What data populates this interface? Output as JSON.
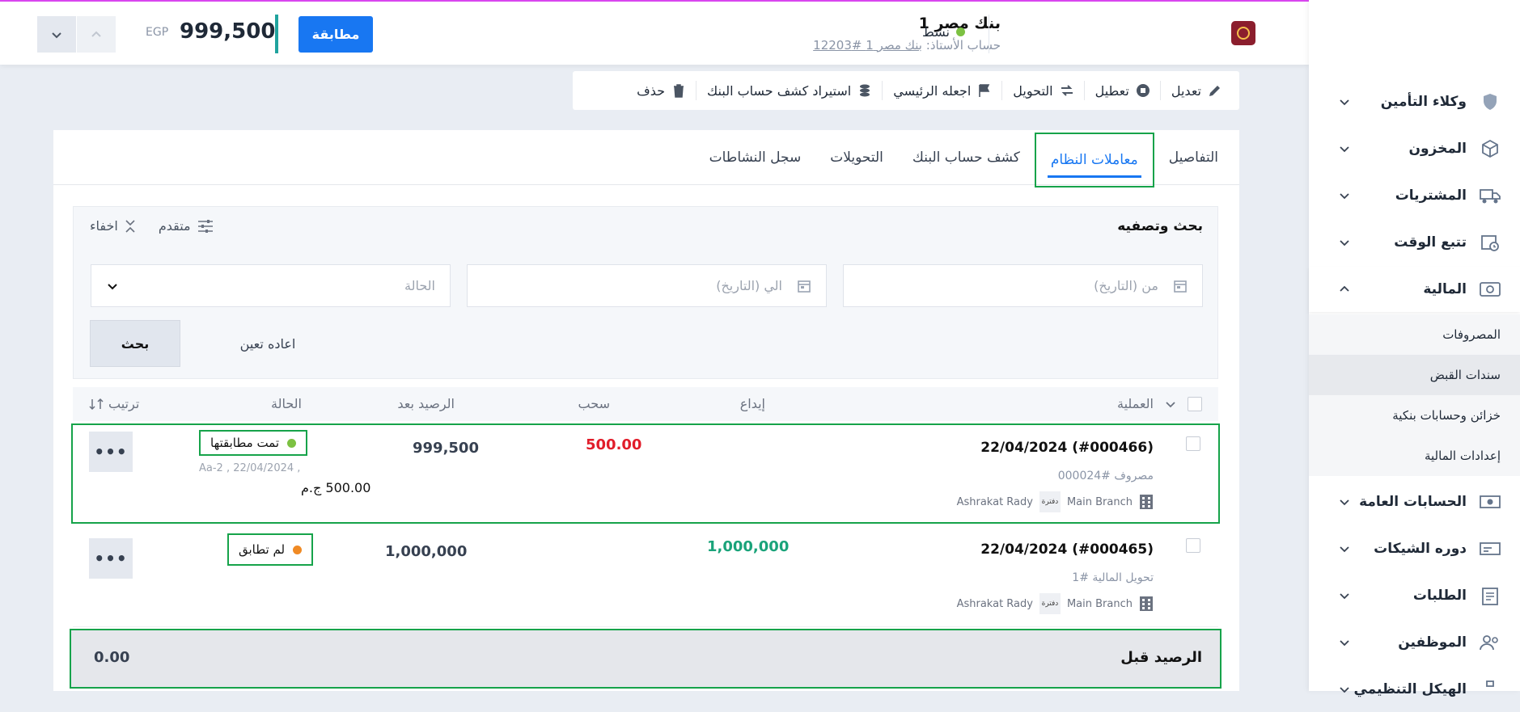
{
  "header": {
    "bank_name": "بنك مصر 1",
    "account_prefix": "حساب الأستاذ:",
    "account_link": "بنك مصر 1 #12203",
    "status": "نشط",
    "match_button": "مطابقة",
    "balance": "999,500",
    "currency": "EGP"
  },
  "toolbar": {
    "edit": "تعديل",
    "disable": "تعطيل",
    "transfer": "التحويل",
    "make_main": "اجعله الرئيسي",
    "import": "استيراد كشف حساب البنك",
    "delete": "حذف"
  },
  "tabs": [
    "التفاصيل",
    "معاملات النظام",
    "كشف حساب البنك",
    "التحويلات",
    "سجل النشاطات"
  ],
  "filter": {
    "title": "بحث وتصفيه",
    "advanced": "متقدم",
    "hide": "اخفاء",
    "from_placeholder": "من (التاريخ)",
    "to_placeholder": "الي (التاريخ)",
    "status_placeholder": "الحالة",
    "search": "بحث",
    "reset": "اعاده تعين"
  },
  "table": {
    "headers": {
      "operation": "العملية",
      "deposit": "إيداع",
      "withdraw": "سحب",
      "balance_after": "الرصيد بعد",
      "status": "الحالة",
      "sort": "ترتيب"
    },
    "rows": [
      {
        "title": "(#000466) 22/04/2024",
        "sub": "مصروف #000024",
        "branch": "Main Branch",
        "chip": "دفترة",
        "user": "Ashrakat Rady",
        "deposit": "",
        "withdraw": "500.00",
        "balance_after": "999,500",
        "status": "تمت مطابقتها",
        "match_info": "Aa-2 , 22/04/2024 ,",
        "match_amount": "500.00 ج.م"
      },
      {
        "title": "(#000465) 22/04/2024",
        "sub": "تحويل المالية #1",
        "branch": "Main Branch",
        "chip": "دفترة",
        "user": "Ashrakat Rady",
        "deposit": "1,000,000",
        "withdraw": "",
        "balance_after": "1,000,000",
        "status": "لم تطابق",
        "match_info": "",
        "match_amount": ""
      }
    ],
    "footer_label": "الرصيد قبل",
    "footer_value": "0.00"
  },
  "sidebar": {
    "items": [
      {
        "label": "وكلاء التأمين",
        "icon": "shield-icon"
      },
      {
        "label": "المخزون",
        "icon": "box-icon"
      },
      {
        "label": "المشتريات",
        "icon": "truck-icon"
      },
      {
        "label": "تتبع الوقت",
        "icon": "calendar-clock-icon"
      },
      {
        "label": "المالية",
        "icon": "money-icon"
      },
      {
        "label": "الحسابات العامة",
        "icon": "cash-icon"
      },
      {
        "label": "دوره الشيكات",
        "icon": "cheque-icon"
      },
      {
        "label": "الطلبات",
        "icon": "clipboard-icon"
      },
      {
        "label": "الموظفين",
        "icon": "users-icon"
      },
      {
        "label": "الهيكل التنظيمي",
        "icon": "org-icon"
      }
    ],
    "sub_items": [
      "المصروفات",
      "سندات القبض",
      "خزائن وحسابات بنكية",
      "إعدادات المالية"
    ]
  },
  "colors": {
    "primary": "#1877f2",
    "matched": "#7cc142",
    "unmatched": "#f08a24",
    "withdraw": "#e11d2a",
    "deposit": "#1aa37a",
    "highlight": "#16a34a"
  }
}
